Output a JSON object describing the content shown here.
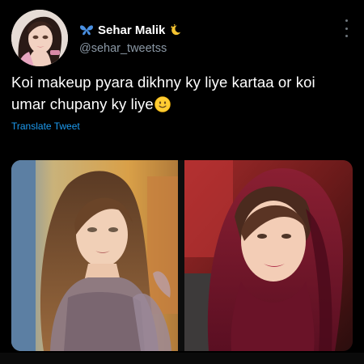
{
  "tweet": {
    "display_name": "Sehar Malik",
    "handle": "@sehar_tweetss",
    "text": "Koi makeup pyara dikhny ky liye kartaa or koi umar chupany ky liye",
    "emoji": "slightly-smiling-face",
    "translate_label": "Translate Tweet"
  },
  "icons": {
    "before_name": "butterfly-icon",
    "after_name": "moon-stars-icon",
    "menu": "more-options-icon"
  },
  "colors": {
    "background": "#000000",
    "primary_text": "#ffffff",
    "secondary_text": "#8b98a5",
    "link": "#1d9bf0",
    "butterfly": "#4a90e2",
    "moon": "#f5c431"
  },
  "media": {
    "photos": [
      {
        "description_name": "photo-left"
      },
      {
        "description_name": "photo-right"
      }
    ]
  }
}
